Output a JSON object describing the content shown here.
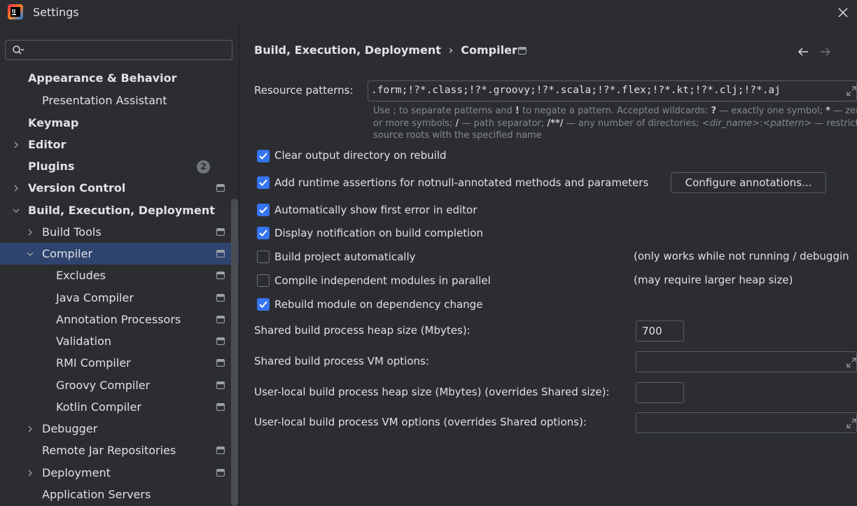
{
  "window": {
    "title": "Settings"
  },
  "search": {
    "placeholder": "",
    "value": ""
  },
  "sidebar": {
    "items": [
      {
        "label": "Appearance & Behavior"
      },
      {
        "label": "Presentation Assistant"
      },
      {
        "label": "Keymap"
      },
      {
        "label": "Editor"
      },
      {
        "label": "Plugins",
        "badge": "2"
      },
      {
        "label": "Version Control"
      },
      {
        "label": "Build, Execution, Deployment"
      },
      {
        "label": "Build Tools"
      },
      {
        "label": "Compiler"
      },
      {
        "label": "Excludes"
      },
      {
        "label": "Java Compiler"
      },
      {
        "label": "Annotation Processors"
      },
      {
        "label": "Validation"
      },
      {
        "label": "RMI Compiler"
      },
      {
        "label": "Groovy Compiler"
      },
      {
        "label": "Kotlin Compiler"
      },
      {
        "label": "Debugger"
      },
      {
        "label": "Remote Jar Repositories"
      },
      {
        "label": "Deployment"
      },
      {
        "label": "Application Servers"
      }
    ]
  },
  "breadcrumb": {
    "parent": "Build, Execution, Deployment",
    "separator": "›",
    "current": "Compiler"
  },
  "resource_patterns": {
    "label": "Resource patterns:",
    "value": ".form;!?*.class;!?*.groovy;!?*.scala;!?*.flex;!?*.kt;!?*.clj;!?*.aj",
    "hint_line1_a": "Use ; to separate patterns and ",
    "hint_line1_b": "!",
    "hint_line1_c": " to negate a pattern. Accepted wildcards: ",
    "hint_line1_d": "?",
    "hint_line1_e": " — exactly one symbol; ",
    "hint_line1_f": "*",
    "hint_line1_g": " — zer",
    "hint_line2_a": "or more symbols; ",
    "hint_line2_b": "/",
    "hint_line2_c": " — path separator; ",
    "hint_line2_d": "/**/",
    "hint_line2_e": " — any number of directories; ",
    "hint_line2_f": "<dir_name>",
    "hint_line2_g": ":",
    "hint_line2_h": "<pattern>",
    "hint_line2_i": " — restrict t",
    "hint_line3": "source roots with the specified name"
  },
  "options": {
    "clear_output": {
      "label": "Clear output directory on rebuild",
      "checked": true
    },
    "runtime_assertions": {
      "label": "Add runtime assertions for notnull-annotated methods and parameters",
      "checked": true
    },
    "configure_annotations": "Configure annotations...",
    "show_first_error": {
      "label": "Automatically show first error in editor",
      "checked": true
    },
    "display_notification": {
      "label": "Display notification on build completion",
      "checked": true
    },
    "build_automatically": {
      "label": "Build project automatically",
      "checked": false,
      "note": "(only works while not running / debuggin"
    },
    "compile_parallel": {
      "label": "Compile independent modules in parallel",
      "checked": false,
      "note": "(may require larger heap size)"
    },
    "rebuild_on_dependency": {
      "label": "Rebuild module on dependency change",
      "checked": true
    }
  },
  "fields": {
    "shared_heap": {
      "label": "Shared build process heap size (Mbytes):",
      "value": "700"
    },
    "shared_vm": {
      "label": "Shared build process VM options:",
      "value": ""
    },
    "local_heap": {
      "label": "User-local build process heap size (Mbytes) (overrides Shared size):",
      "value": ""
    },
    "local_vm": {
      "label": "User-local build process VM options (overrides Shared options):",
      "value": ""
    }
  },
  "colors": {
    "accent": "#3574f0",
    "selection": "#2e436e",
    "background": "#2b2d30",
    "hint": "#868a91"
  }
}
